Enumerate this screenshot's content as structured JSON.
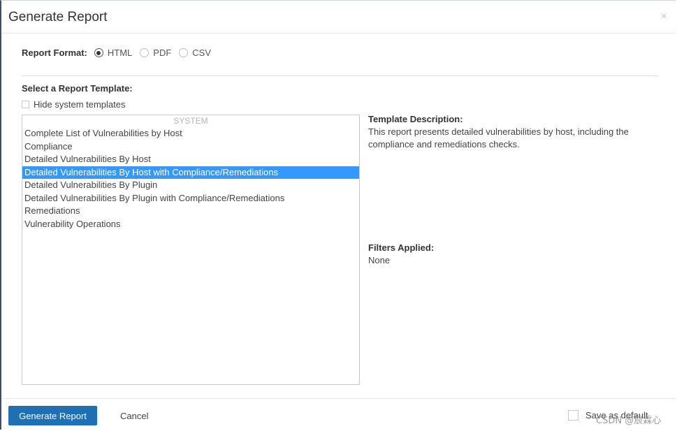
{
  "dialog": {
    "title": "Generate Report",
    "close_glyph": "×"
  },
  "format": {
    "label": "Report Format:",
    "options": [
      {
        "label": "HTML",
        "checked": true
      },
      {
        "label": "PDF",
        "checked": false
      },
      {
        "label": "CSV",
        "checked": false
      }
    ]
  },
  "template": {
    "section_title": "Select a Report Template:",
    "hide_system_label": "Hide system templates",
    "group_label": "SYSTEM",
    "items": [
      {
        "label": "Complete List of Vulnerabilities by Host"
      },
      {
        "label": "Compliance"
      },
      {
        "label": "Detailed Vulnerabilities By Host"
      },
      {
        "label": "Detailed Vulnerabilities By Host with Compliance/Remediations",
        "selected": true
      },
      {
        "label": "Detailed Vulnerabilities By Plugin"
      },
      {
        "label": "Detailed Vulnerabilities By Plugin with Compliance/Remediations"
      },
      {
        "label": "Remediations"
      },
      {
        "label": "Vulnerability Operations"
      }
    ]
  },
  "description": {
    "title": "Template Description:",
    "text": "This report presents detailed vulnerabilities by host, including the compliance and remediations checks."
  },
  "filters": {
    "title": "Filters Applied:",
    "value": "None"
  },
  "footer": {
    "generate_label": "Generate Report",
    "cancel_label": "Cancel",
    "save_default_label": "Save as default"
  },
  "watermark": "CSDN @辰霖心",
  "colors": {
    "primary": "#1e6fb3",
    "selected": "#3399ff"
  }
}
